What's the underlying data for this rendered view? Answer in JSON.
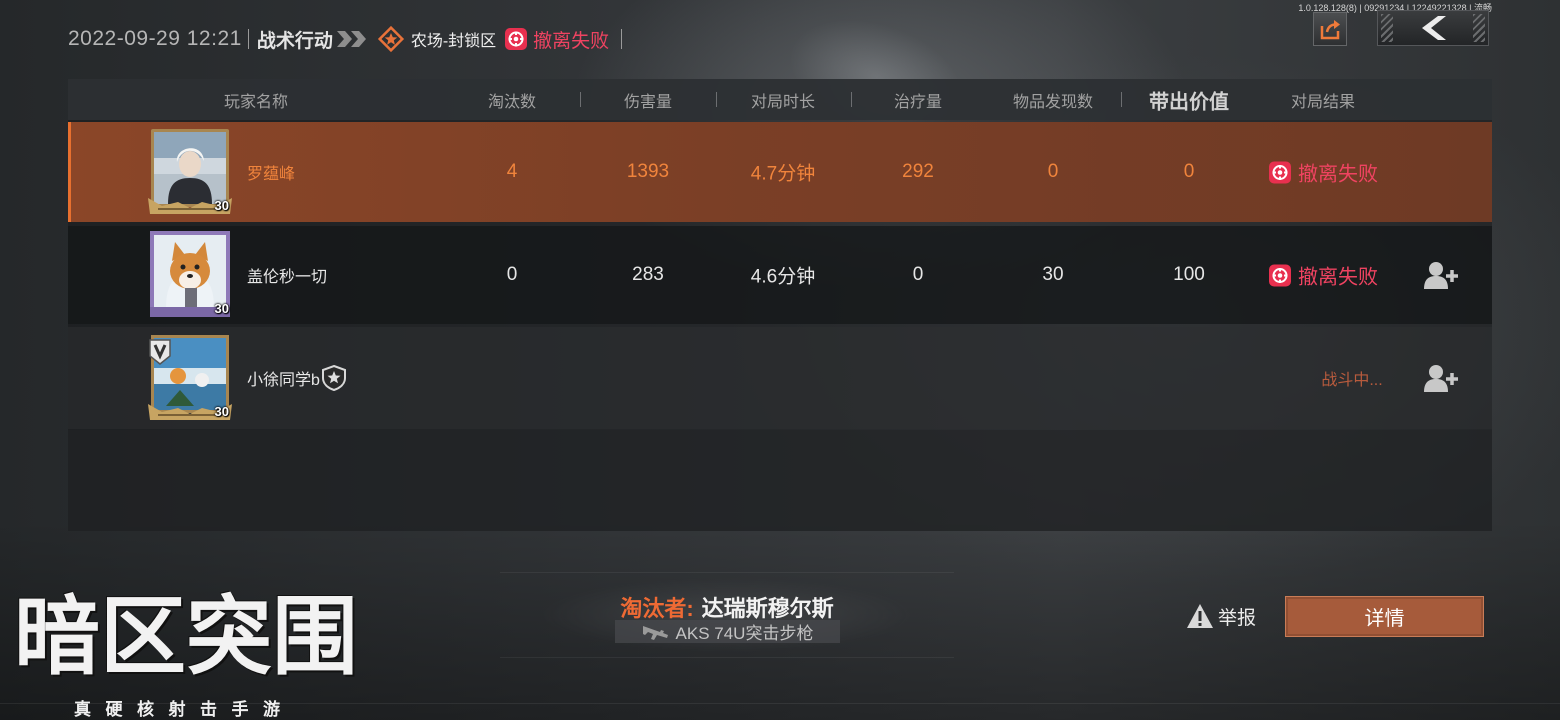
{
  "header": {
    "datetime": "2022-09-29 12:21",
    "mode": "战术行动",
    "map": "农场-封锁区",
    "status": "撤离失败"
  },
  "version_info": "1.0.128.128(8) | 09291234 | 12249221328 | 流畅",
  "table": {
    "columns": {
      "player_name": "玩家名称",
      "eliminations": "淘汰数",
      "damage": "伤害量",
      "duration": "对局时长",
      "healing": "治疗量",
      "items_found": "物品发现数",
      "extracted_value": "带出价值",
      "result": "对局结果"
    },
    "rows": [
      {
        "name": "罗蕴峰",
        "level": "30",
        "eliminations": "4",
        "damage": "1393",
        "duration": "4.7分钟",
        "healing": "292",
        "items_found": "0",
        "extracted_value": "0",
        "result": "撤离失败",
        "highlighted": true
      },
      {
        "name": "盖伦秒一切",
        "level": "30",
        "eliminations": "0",
        "damage": "283",
        "duration": "4.6分钟",
        "healing": "0",
        "items_found": "30",
        "extracted_value": "100",
        "result": "撤离失败",
        "highlighted": false
      },
      {
        "name": "小徐同学b",
        "level": "30",
        "result": "战斗中...",
        "highlighted": false
      }
    ]
  },
  "eliminated_by": {
    "label": "淘汰者:",
    "name": "达瑞斯穆尔斯",
    "weapon": "AKS 74U突击步枪"
  },
  "actions": {
    "report": "举报",
    "details": "详情"
  },
  "logo": {
    "title": "暗区突围",
    "subtitle": "真硬核射击手游"
  },
  "icons": {
    "mode_separator": "double-chevron-icon",
    "map": "map-marker-icon",
    "status": "extraction-failed-icon",
    "share": "share-icon",
    "back": "back-chevron-icon",
    "add_friend": "add-friend-icon",
    "player_badge": "shield-star-icon",
    "rank_badge": "rank-v-badge-icon",
    "report": "warning-icon",
    "weapon": "rifle-icon"
  },
  "colors": {
    "accent_orange": "#f0843c",
    "fail_red": "#ef4361",
    "highlight_border": "#e8702f",
    "in_battle": "#b85b3d",
    "details_button": "#a65b3b"
  }
}
